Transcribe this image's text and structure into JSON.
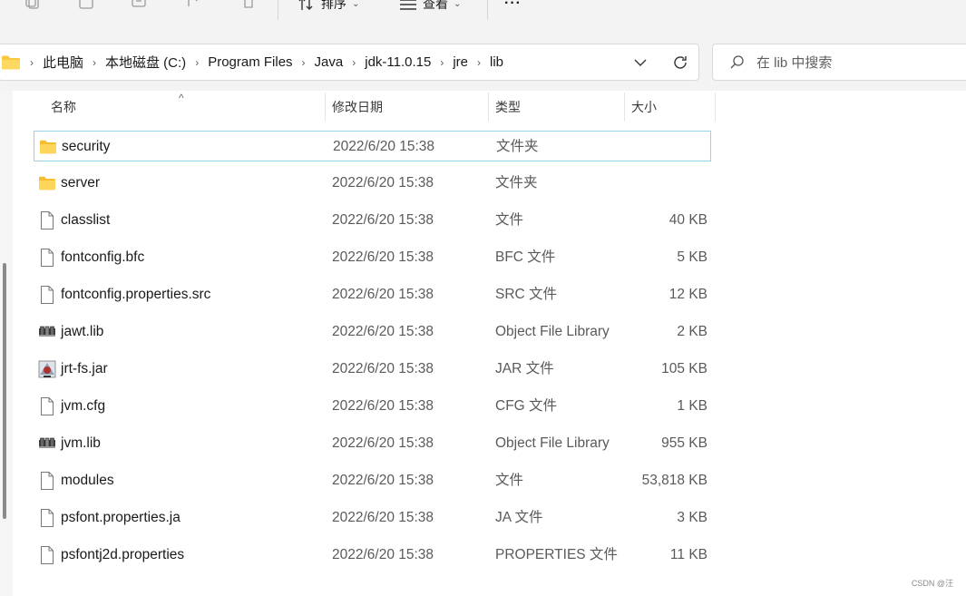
{
  "toolbar": {
    "sort_label": "排序",
    "view_label": "查看",
    "more_label": "···"
  },
  "address": {
    "crumbs": [
      "此电脑",
      "本地磁盘 (C:)",
      "Program Files",
      "Java",
      "jdk-11.0.15",
      "jre",
      "lib"
    ]
  },
  "search": {
    "placeholder": "在 lib 中搜索"
  },
  "columns": {
    "name": "名称",
    "date": "修改日期",
    "type": "类型",
    "size": "大小",
    "sort_indicator": "^"
  },
  "files": [
    {
      "name": "security",
      "date": "2022/6/20 15:38",
      "type": "文件夹",
      "size": "",
      "icon": "folder-icon"
    },
    {
      "name": "server",
      "date": "2022/6/20 15:38",
      "type": "文件夹",
      "size": "",
      "icon": "folder-icon"
    },
    {
      "name": "classlist",
      "date": "2022/6/20 15:38",
      "type": "文件",
      "size": "40 KB",
      "icon": "file-icon"
    },
    {
      "name": "fontconfig.bfc",
      "date": "2022/6/20 15:38",
      "type": "BFC 文件",
      "size": "5 KB",
      "icon": "file-icon"
    },
    {
      "name": "fontconfig.properties.src",
      "date": "2022/6/20 15:38",
      "type": "SRC 文件",
      "size": "12 KB",
      "icon": "file-icon"
    },
    {
      "name": "jawt.lib",
      "date": "2022/6/20 15:38",
      "type": "Object File Library",
      "size": "2 KB",
      "icon": "lib-icon"
    },
    {
      "name": "jrt-fs.jar",
      "date": "2022/6/20 15:38",
      "type": "JAR 文件",
      "size": "105 KB",
      "icon": "jar-icon"
    },
    {
      "name": "jvm.cfg",
      "date": "2022/6/20 15:38",
      "type": "CFG 文件",
      "size": "1 KB",
      "icon": "file-icon"
    },
    {
      "name": "jvm.lib",
      "date": "2022/6/20 15:38",
      "type": "Object File Library",
      "size": "955 KB",
      "icon": "lib-icon"
    },
    {
      "name": "modules",
      "date": "2022/6/20 15:38",
      "type": "文件",
      "size": "53,818 KB",
      "icon": "file-icon"
    },
    {
      "name": "psfont.properties.ja",
      "date": "2022/6/20 15:38",
      "type": "JA 文件",
      "size": "3 KB",
      "icon": "file-icon"
    },
    {
      "name": "psfontj2d.properties",
      "date": "2022/6/20 15:38",
      "type": "PROPERTIES 文件",
      "size": "11 KB",
      "icon": "file-icon"
    }
  ],
  "selected_index": 0,
  "watermark": "CSDN @汪"
}
